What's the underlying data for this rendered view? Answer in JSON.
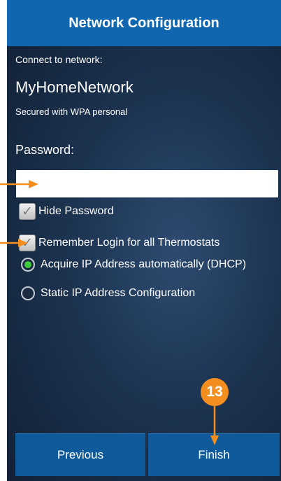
{
  "header": {
    "title": "Network Configuration"
  },
  "network": {
    "connect_label": "Connect to network:",
    "name": "MyHomeNetwork",
    "security": "Secured with WPA personal"
  },
  "password": {
    "label": "Password:",
    "value": ""
  },
  "options": {
    "hide_password": {
      "label": "Hide Password",
      "checked": true
    },
    "remember_login": {
      "label": "Remember Login for all Thermostats",
      "checked": true
    }
  },
  "ip_config": {
    "dhcp_label": "Acquire IP Address automatically (DHCP)",
    "static_label": "Static IP Address Configuration",
    "selected": "dhcp"
  },
  "buttons": {
    "previous": "Previous",
    "finish": "Finish"
  },
  "annotation": {
    "step": "13",
    "color": "#f48f1f"
  },
  "colors": {
    "header": "#1166b0",
    "button": "#0f5a9a",
    "radio_selected": "#3ecb3a"
  }
}
